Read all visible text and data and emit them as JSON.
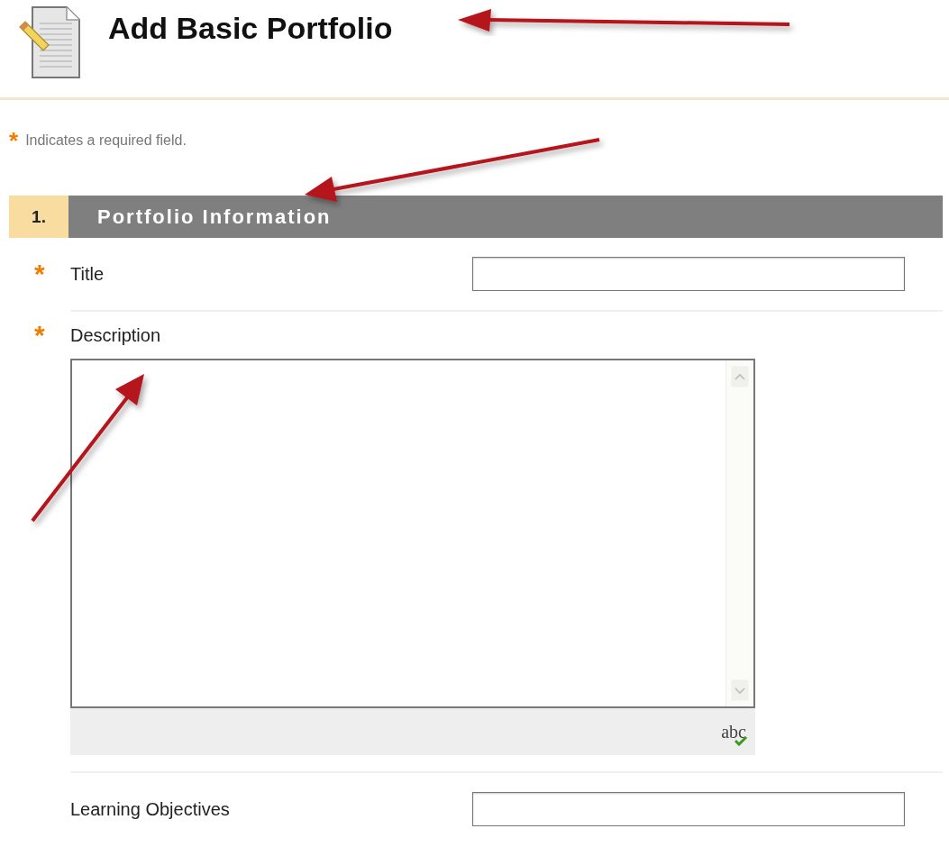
{
  "page": {
    "title": "Add Basic Portfolio"
  },
  "legend": {
    "mark": "*",
    "text": "Indicates a required field."
  },
  "section": {
    "number": "1.",
    "title": "Portfolio Information",
    "fields": [
      {
        "kind": "text",
        "label": "Title",
        "required": true
      },
      {
        "kind": "textarea",
        "label": "Description",
        "required": true,
        "spellcheck": "abc"
      },
      {
        "kind": "text",
        "label": "Learning Objectives",
        "required": false
      }
    ]
  }
}
